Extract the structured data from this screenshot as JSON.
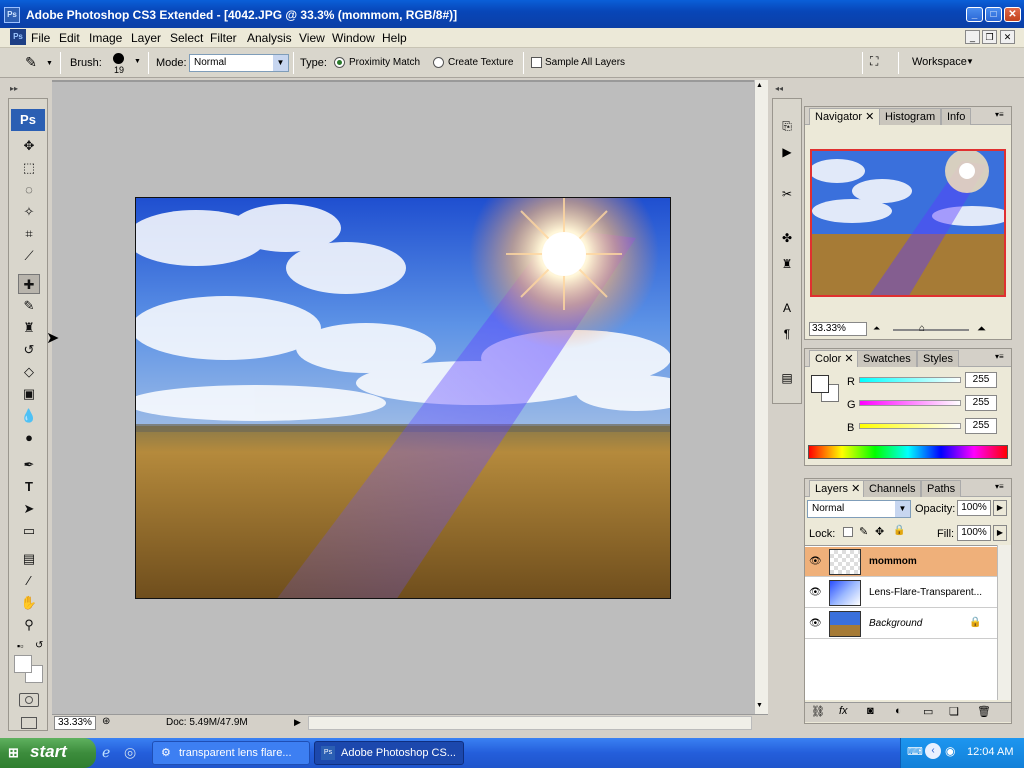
{
  "window": {
    "title": "Adobe Photoshop CS3 Extended - [4042.JPG @ 33.3% (mommom, RGB/8#)]",
    "app_icon": "Ps"
  },
  "menu": [
    "File",
    "Edit",
    "Image",
    "Layer",
    "Select",
    "Filter",
    "Analysis",
    "View",
    "Window",
    "Help"
  ],
  "options": {
    "brush_label": "Brush:",
    "brush_size": "19",
    "mode_label": "Mode:",
    "mode_value": "Normal",
    "type_label": "Type:",
    "proximity_label": "Proximity Match",
    "texture_label": "Create Texture",
    "sample_label": "Sample All Layers",
    "workspace_label": "Workspace"
  },
  "toolbox": {
    "logo": "Ps"
  },
  "status": {
    "zoom": "33.33%",
    "doc": "Doc: 5.49M/47.9M"
  },
  "navigator": {
    "tabs": [
      "Navigator",
      "Histogram",
      "Info"
    ],
    "zoom": "33.33%"
  },
  "color": {
    "tabs": [
      "Color",
      "Swatches",
      "Styles"
    ],
    "r_label": "R",
    "g_label": "G",
    "b_label": "B",
    "r": "255",
    "g": "255",
    "b": "255"
  },
  "layers": {
    "tabs": [
      "Layers",
      "Channels",
      "Paths"
    ],
    "blend_mode": "Normal",
    "opacity_label": "Opacity:",
    "opacity": "100%",
    "lock_label": "Lock:",
    "fill_label": "Fill:",
    "fill": "100%",
    "items": [
      {
        "name": "mommom",
        "selected": true
      },
      {
        "name": "Lens-Flare-Transparent...",
        "selected": false
      },
      {
        "name": "Background",
        "selected": false
      }
    ]
  },
  "taskbar": {
    "start": "start",
    "tasks": [
      "transparent lens flare...",
      "Adobe Photoshop CS..."
    ],
    "clock": "12:04 AM"
  },
  "colors": {
    "selected_layer": "#efb07a",
    "title_bar": "#0a5fd8"
  }
}
